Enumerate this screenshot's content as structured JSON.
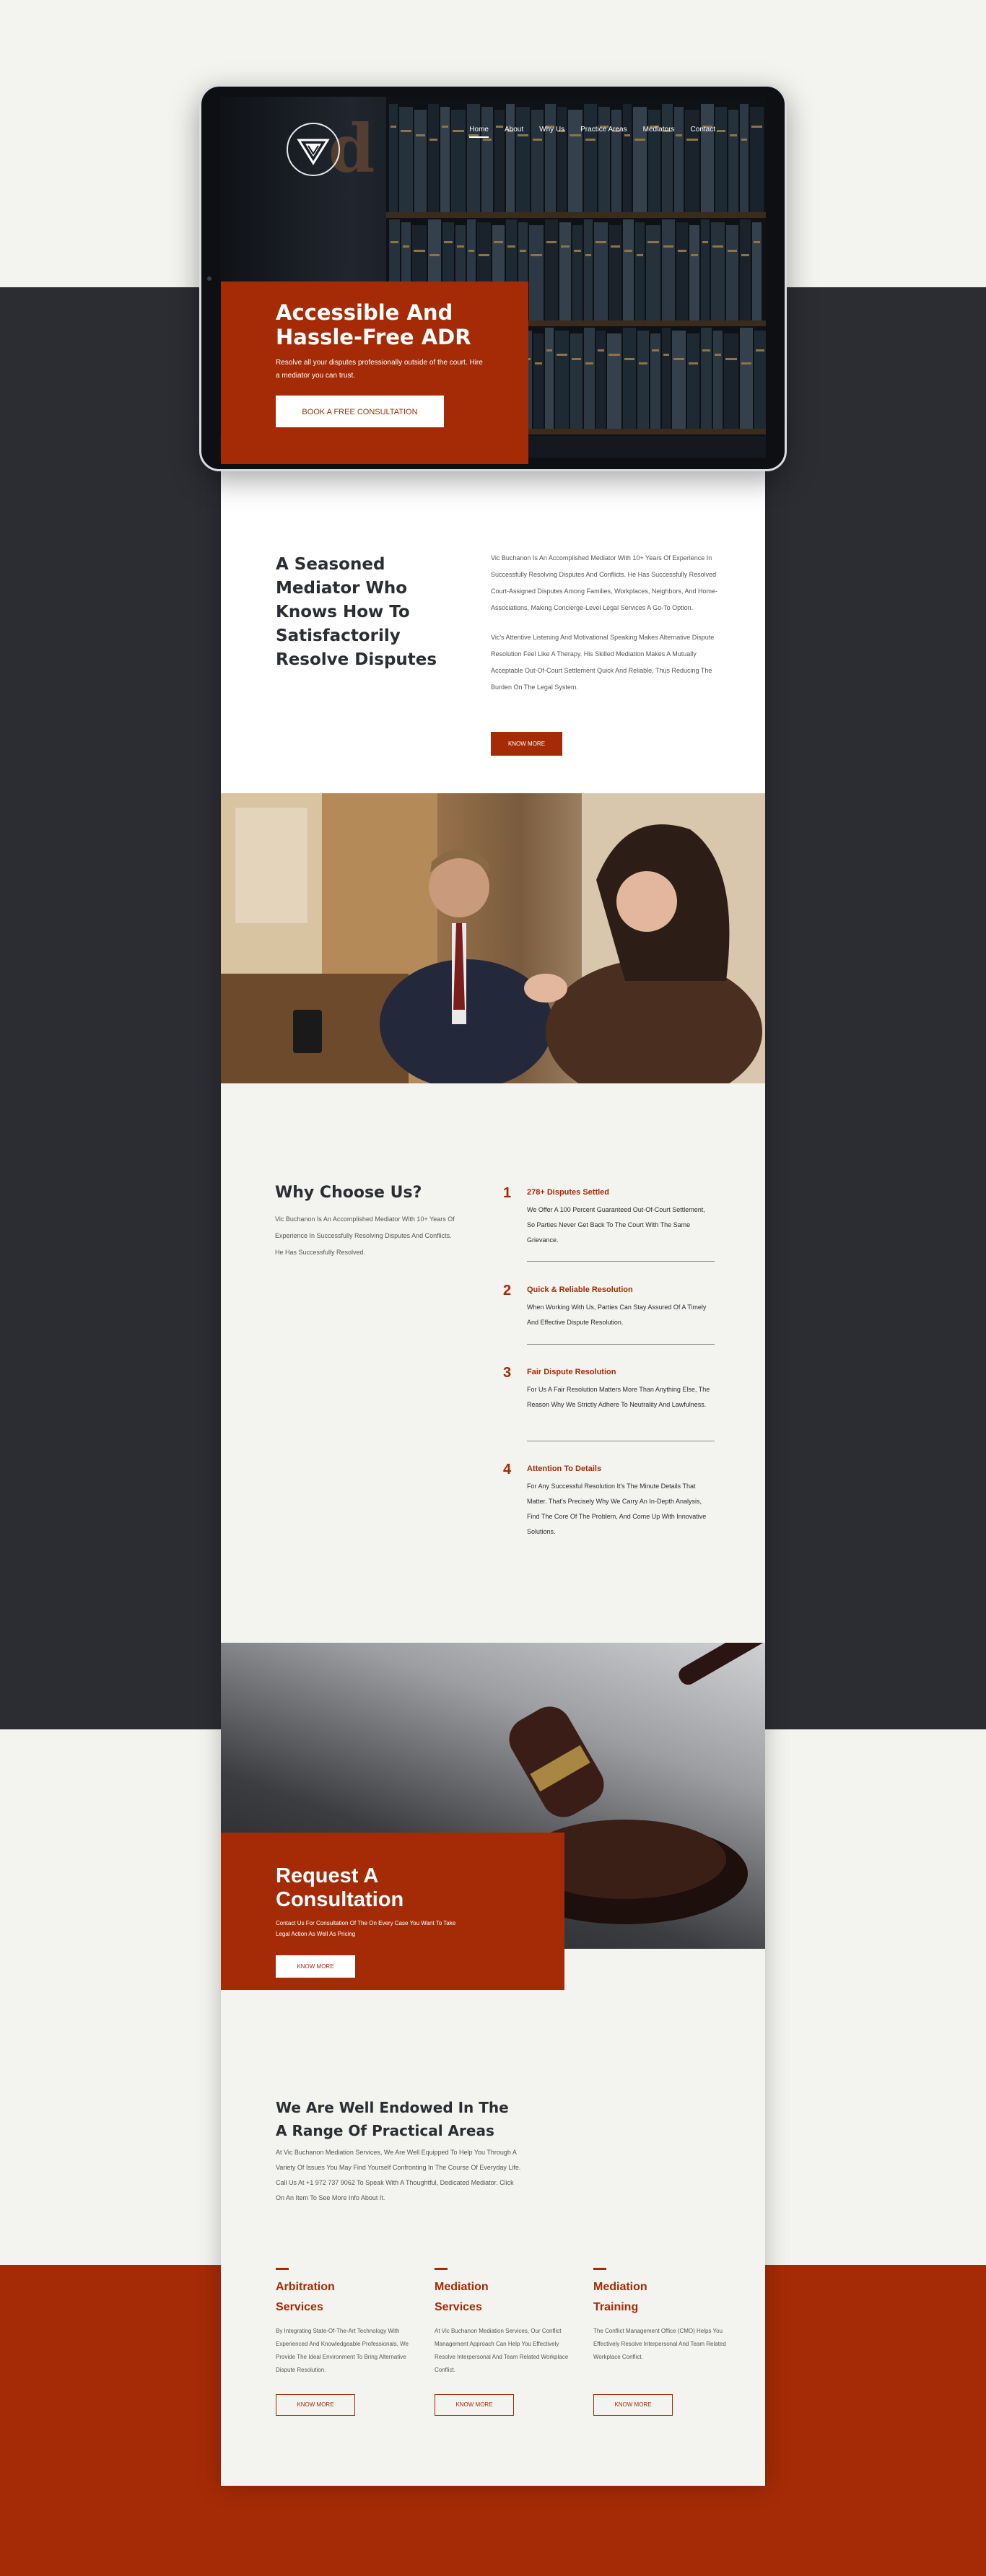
{
  "colors": {
    "rust": "#a52b06",
    "dark": "#2b2d33",
    "cream": "#f3f3ef"
  },
  "nav": {
    "items": [
      "Home",
      "About",
      "Why Us",
      "Practice Areas",
      "Mediators",
      "Contact"
    ],
    "active": "Home"
  },
  "hero": {
    "title_line1": "Accessible And",
    "title_line2": "Hassle-Free ADR",
    "subtitle": "Resolve all your disputes professionally outside of the court. Hire a mediator you can trust.",
    "cta": "BOOK A FREE CONSULTATION"
  },
  "mediator": {
    "title": "A Seasoned Mediator Who Knows How To Satisfactorily Resolve Disputes",
    "para1": "Vic Buchanon Is An Accomplished Mediator With 10+ Years Of Experience In Successfully Resolving Disputes And Conflicts. He Has Successfully Resolved Court-Assigned Disputes Among Families, Workplaces, Neighbors, And Home-Associations, Making Concierge-Level Legal Services A Go-To Option.",
    "para2": "Vic's Attentive Listening And Motivational Speaking Makes Alternative Dispute Resolution Feel Like A Therapy. His Skilled Mediation Makes A Mutually Acceptable Out-Of-Court Settlement Quick And Reliable, Thus Reducing The Burden On The Legal System.",
    "button": "KNOW MORE"
  },
  "why": {
    "title": "Why Choose Us?",
    "text": "Vic Buchanon Is An Accomplished Mediator With 10+ Years Of Experience In Successfully Resolving Disputes And Conflicts. He Has Successfully Resolved.",
    "items": [
      {
        "num": "1",
        "title": "278+ Disputes Settled",
        "text": "We Offer A 100 Percent Guaranteed Out-Of-Court Settlement, So Parties Never Get Back To The Court With The Same Grievance."
      },
      {
        "num": "2",
        "title": "Quick & Reliable Resolution",
        "text": "When Working With Us, Parties Can Stay Assured Of A Timely And Effective Dispute Resolution."
      },
      {
        "num": "3",
        "title": "Fair Dispute Resolution",
        "text": "For Us A Fair Resolution Matters More Than Anything Else, The Reason Why We Strictly Adhere To Neutrality And Lawfulness."
      },
      {
        "num": "4",
        "title": "Attention To Details",
        "text": "For Any Successful Resolution It's The Minute Details That Matter. That's Precisely Why We Carry An In-Depth Analysis, Find The Core Of The Problem, And Come Up With Innovative Solutions."
      }
    ]
  },
  "request": {
    "title": "Request A Consultation",
    "text": "Contact Us For Consultation Of The On Every Case You Want To Take Legal Action As Well As Pricing",
    "button": "KNOW MORE"
  },
  "practice": {
    "title": "We Are Well Endowed In The A Range Of Practical Areas",
    "text": "At Vic Buchanon Mediation Services, We Are Well Equipped To Help You Through A Variety Of Issues You May Find Yourself Confronting In The Course Of Everyday Life. Call Us At +1 972 737 9062 To Speak With A Thoughtful, Dedicated Mediator. Click On An Item To See More Info About It.",
    "services": [
      {
        "title_line1": "Arbitration",
        "title_line2": "Services",
        "text": "By Integrating State-Of-The-Art Technology With Experienced And Knowledgeable Professionals, We Provide The Ideal Environment To Bring Alternative Dispute Resolution.",
        "button": "KNOW MORE"
      },
      {
        "title_line1": "Mediation",
        "title_line2": "Services",
        "text": "At Vic Buchanon Mediation Services, Our Conflict Management Approach Can Help You Effectively Resolve Interpersonal And Team Related Workplace Conflict.",
        "button": "KNOW MORE"
      },
      {
        "title_line1": "Mediation",
        "title_line2": "Training",
        "text": "The Conflict Management Office (CMO) Helps You Effectively Resolve Interpersonal And Team Related Workplace Conflict.",
        "button": "KNOW MORE"
      }
    ]
  }
}
